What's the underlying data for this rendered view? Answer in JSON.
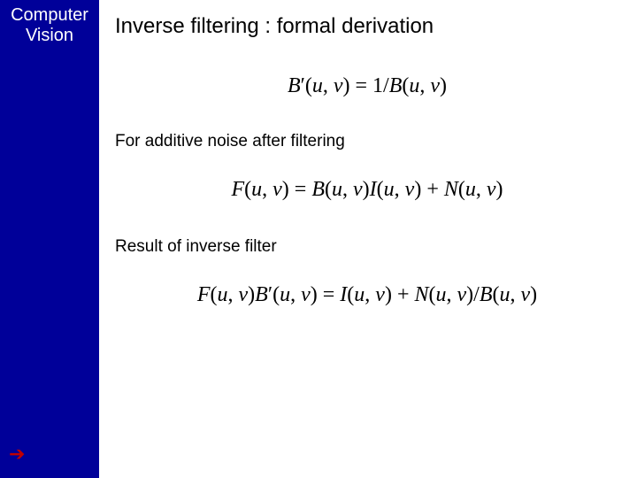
{
  "sidebar": {
    "title_line1": "Computer",
    "title_line2": "Vision",
    "arrow_glyph": "➔"
  },
  "content": {
    "heading": "Inverse filtering  : formal derivation",
    "eq1": "B′(u, v) = 1/B(u, v)",
    "caption1": "For additive noise after filtering",
    "eq2": "F(u, v) = B(u, v)I(u, v) + N(u, v)",
    "caption2": "Result of inverse filter",
    "eq3": "F(u, v)B′(u, v) = I(u, v) + N(u, v)/B(u, v)"
  }
}
